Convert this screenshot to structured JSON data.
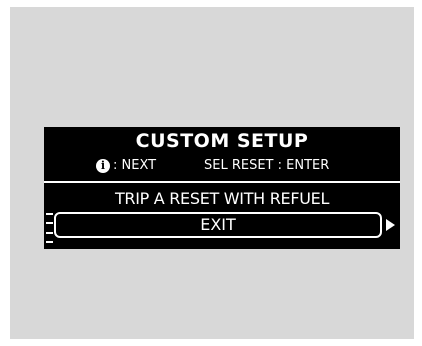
{
  "screen": {
    "title": "CUSTOM SETUP",
    "hint_next": ": NEXT",
    "hint_select": "SEL RESET : ENTER",
    "menu_item": "TRIP A RESET WITH REFUEL",
    "selected_option": "EXIT",
    "info_icon": "info-icon",
    "colors": {
      "background": "#d8d8d8",
      "display": "#000000",
      "text": "#ffffff"
    }
  }
}
